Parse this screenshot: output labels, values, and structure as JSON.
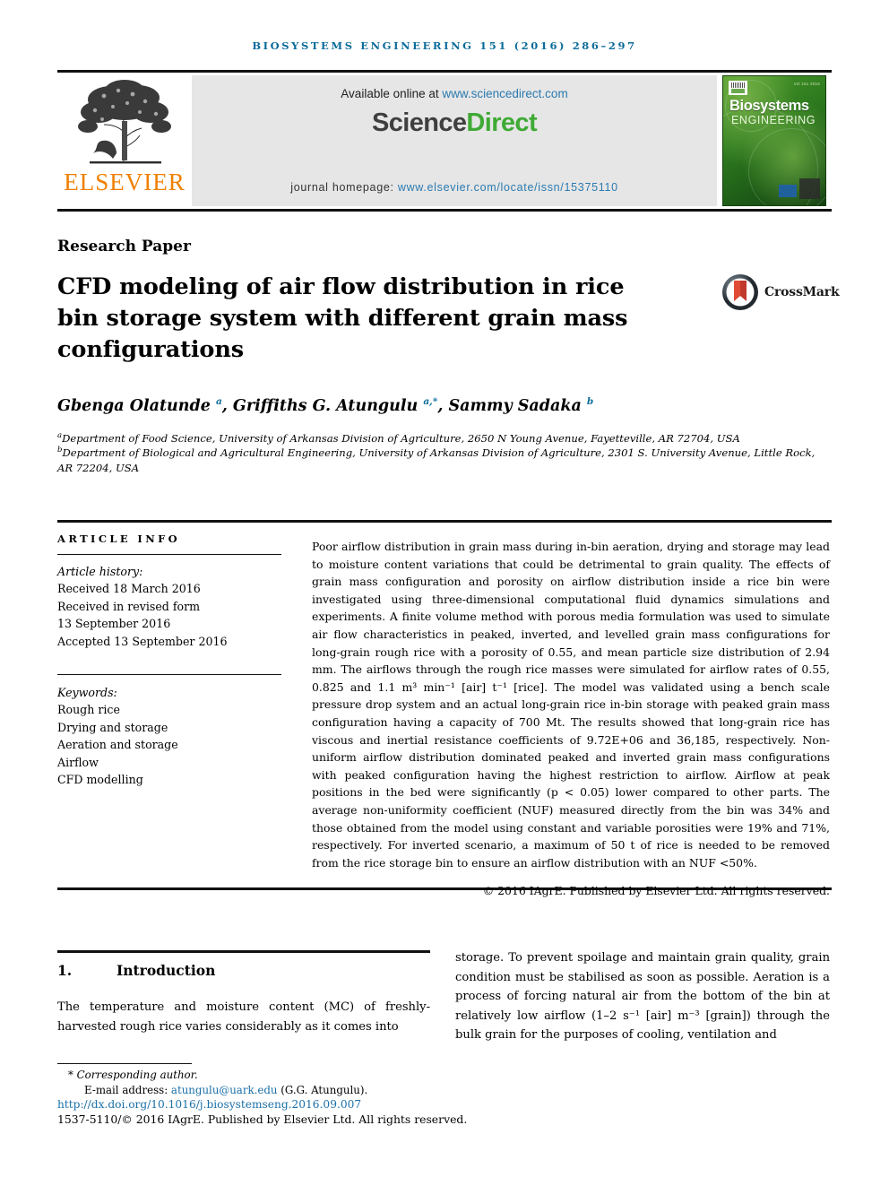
{
  "running_head": "Biosystems Engineering 151 (2016) 286–297",
  "masthead": {
    "elsevier_wordmark": "ELSEVIER",
    "available_prefix": "Available online at ",
    "available_url": "www.sciencedirect.com",
    "sciencedirect_part1": "Science",
    "sciencedirect_part2": "Direct",
    "homepage_label": "journal homepage: ",
    "homepage_url": "www.elsevier.com/locate/issn/15375110",
    "cover": {
      "title": "Biosystems",
      "subtitle": "ENGINEERING",
      "issue_line": "Vol 151 2016"
    }
  },
  "article": {
    "type": "Research Paper",
    "title": "CFD modeling of air flow distribution in rice bin storage system with different grain mass configurations",
    "crossmark_label": "CrossMark",
    "authors_html": "Gbenga Olatunde <sup>a</sup>, Griffiths G. Atungulu <sup>a,*</sup>, Sammy Sadaka <sup>b</sup>",
    "affiliations": [
      "Department of Food Science, University of Arkansas Division of Agriculture, 2650 N Young Avenue, Fayetteville, AR 72704, USA",
      "Department of Biological and Agricultural Engineering, University of Arkansas Division of Agriculture, 2301 S. University Avenue, Little Rock, AR 72204, USA"
    ],
    "affiliation_marks": [
      "a",
      "b"
    ]
  },
  "article_info": {
    "heading": "ARTICLE INFO",
    "history_label": "Article history:",
    "history": [
      "Received 18 March 2016",
      "Received in revised form",
      "13 September 2016",
      "Accepted 13 September 2016"
    ],
    "keywords_label": "Keywords:",
    "keywords": [
      "Rough rice",
      "Drying and storage",
      "Aeration and storage",
      "Airflow",
      "CFD modelling"
    ]
  },
  "abstract": {
    "text": "Poor airflow distribution in grain mass during in-bin aeration, drying and storage may lead to moisture content variations that could be detrimental to grain quality. The effects of grain mass configuration and porosity on airflow distribution inside a rice bin were investigated using three-dimensional computational fluid dynamics simulations and experiments. A finite volume method with porous media formulation was used to simulate air flow characteristics in peaked, inverted, and levelled grain mass configurations for long-grain rough rice with a porosity of 0.55, and mean particle size distribution of 2.94 mm. The airflows through the rough rice masses were simulated for airflow rates of 0.55, 0.825 and 1.1 m³ min⁻¹ [air] t⁻¹ [rice]. The model was validated using a bench scale pressure drop system and an actual long-grain rice in-bin storage with peaked grain mass configuration having a capacity of 700 Mt. The results showed that long-grain rice has viscous and inertial resistance coefficients of 9.72E+06 and 36,185, respectively. Non-uniform airflow distribution dominated peaked and inverted grain mass configurations with peaked configuration having the highest restriction to airflow. Airflow at peak positions in the bed were significantly (p < 0.05) lower compared to other parts. The average non-uniformity coefficient (NUF) measured directly from the bin was 34% and those obtained from the model using constant and variable porosities were 19% and 71%, respectively. For inverted scenario, a maximum of 50 t of rice is needed to be removed from the rice storage bin to ensure an airflow distribution with an NUF <50%.",
    "copyright": "© 2016 IAgrE. Published by Elsevier Ltd. All rights reserved."
  },
  "body": {
    "section_number": "1.",
    "section_title": "Introduction",
    "column_left": "The temperature and moisture content (MC) of freshly-harvested rough rice varies considerably as it comes into",
    "column_right": "storage. To prevent spoilage and maintain grain quality, grain condition must be stabilised as soon as possible. Aeration is a process of forcing natural air from the bottom of the bin at relatively low airflow (1–2 s⁻¹ [air] m⁻³ [grain]) through the bulk grain for the purposes of cooling, ventilation and"
  },
  "footer": {
    "corresponding_star": "*",
    "corresponding_label": "Corresponding author.",
    "email_label": "E-mail address: ",
    "email_value": "atungulu@uark.edu",
    "email_owner": " (G.G. Atungulu).",
    "doi": "http://dx.doi.org/10.1016/j.biosystemseng.2016.09.007",
    "issn_line": "1537-5110/© 2016 IAgrE. Published by Elsevier Ltd. All rights reserved."
  },
  "colors": {
    "header_blue": "#0a6c9a",
    "link_blue": "#1a6fa8",
    "elsevier_orange": "#f08000",
    "sciencedirect_green": "#3faa35",
    "banner_grey": "#e6e6e6"
  }
}
